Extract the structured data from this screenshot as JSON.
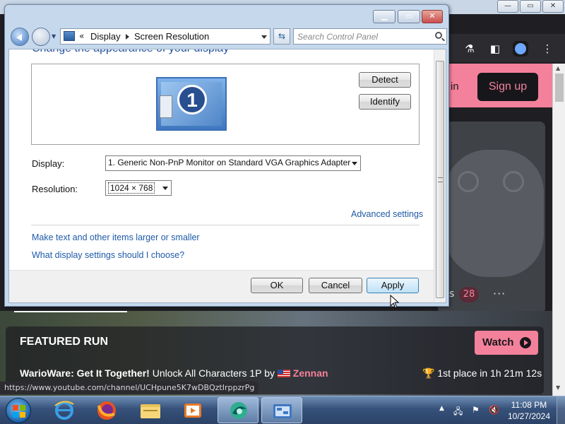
{
  "browser": {
    "site_header": {
      "login_partial": "in",
      "signup_label": "Sign up"
    },
    "comments": {
      "suffix_partial": "s",
      "count": "28",
      "more_label": "···"
    },
    "featured": {
      "title": "FEATURED RUN",
      "watch_label": "Watch",
      "game": "WarioWare: Get It Together!",
      "category": " Unlock All Characters 1P by ",
      "runner": "Zennan",
      "place": "🏆 1st place in 1h 21m 12s"
    },
    "status_url": "https://www.youtube.com/channel/UCHpune5K7wDBQztIrppzrPg"
  },
  "control_panel": {
    "address": {
      "chevrons": "«",
      "crumbs": [
        "Display",
        "Screen Resolution"
      ]
    },
    "search_placeholder": "Search Control Panel",
    "heading": "Change the appearance of your display",
    "monitor_number": "1",
    "detect_label": "Detect",
    "identify_label": "Identify",
    "display_label": "Display:",
    "display_value": "1. Generic Non-PnP Monitor on Standard VGA Graphics Adapter",
    "resolution_label": "Resolution:",
    "resolution_value": "1024 × 768",
    "advanced_settings": "Advanced settings",
    "link_text_size": "Make text and other items larger or smaller",
    "link_help": "What display settings should I choose?",
    "ok_label": "OK",
    "cancel_label": "Cancel",
    "apply_label": "Apply"
  },
  "taskbar": {
    "time": "11:08 PM",
    "date": "10/27/2024",
    "apps": [
      "internet-explorer",
      "firefox",
      "file-explorer",
      "media-player",
      "browser-active",
      "control-panel"
    ]
  },
  "colors": {
    "accent_pink": "#f4819b",
    "link_blue": "#1e5aa8",
    "heading_blue": "#1e4c9a"
  }
}
